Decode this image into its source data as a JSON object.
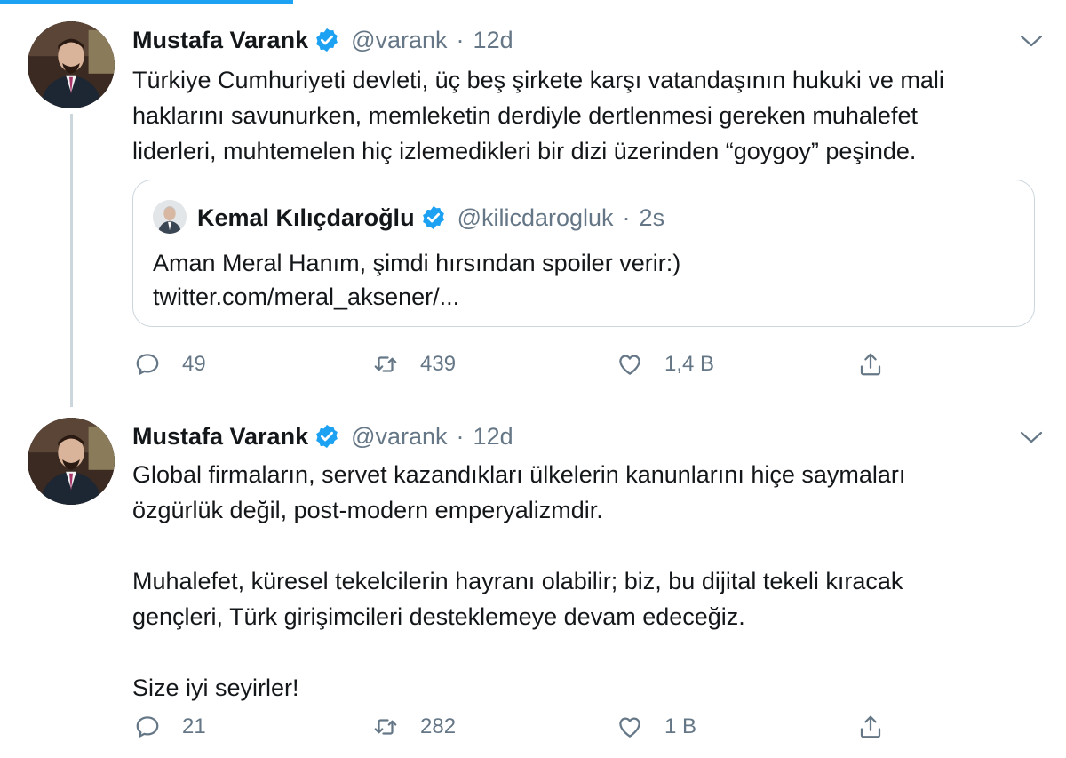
{
  "tweets": [
    {
      "author": {
        "name": "Mustafa Varank",
        "handle": "@varank",
        "time": "12d"
      },
      "text": "Türkiye Cumhuriyeti devleti, üç beş şirkete karşı vatandaşının hukuki ve mali\nhaklarını savunurken, memleketin derdiyle dertlenmesi gereken muhalefet\nliderleri, muhtemelen hiç izlemedikleri bir dizi üzerinden “goygoy” peşinde.",
      "quote": {
        "author": {
          "name": "Kemal Kılıçdaroğlu",
          "handle": "@kilicdarogluk",
          "time": "2s"
        },
        "text": "Aman Meral Hanım, şimdi hırsından spoiler verir:)\ntwitter.com/meral_aksener/..."
      },
      "actions": {
        "replies": "49",
        "retweets": "439",
        "likes": "1,4 B"
      }
    },
    {
      "author": {
        "name": "Mustafa Varank",
        "handle": "@varank",
        "time": "12d"
      },
      "text": "Global firmaların, servet kazandıkları ülkelerin kanunlarını hiçe saymaları\nözgürlük değil, post-modern emperyalizmdir.\n\nMuhalefet, küresel tekelcilerin hayranı olabilir; biz, bu dijital tekeli kıracak\ngençleri, Türk girişimcileri desteklemeye devam edeceğiz.\n\nSize iyi seyirler!",
      "actions": {
        "replies": "21",
        "retweets": "282",
        "likes": "1 B"
      }
    }
  ],
  "icons": {
    "verified": "verified-badge-icon",
    "caret": "chevron-down-icon",
    "reply": "reply-icon",
    "retweet": "retweet-icon",
    "like": "heart-icon",
    "share": "share-icon"
  },
  "colors": {
    "accent": "#1da1f2",
    "secondary_text": "#657786",
    "border": "#ccd6dd"
  }
}
